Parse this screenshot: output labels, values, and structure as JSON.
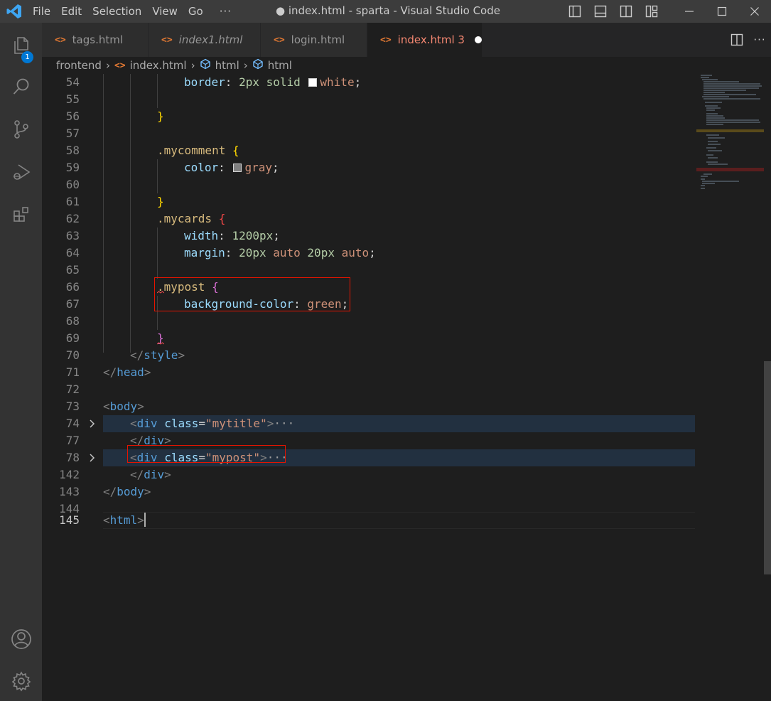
{
  "titlebar": {
    "menu": [
      "File",
      "Edit",
      "Selection",
      "View",
      "Go"
    ],
    "more": "···",
    "title": "● index.html - sparta - Visual Studio Code",
    "logo_icon": "vscode-logo-icon",
    "layout_icons": [
      "toggle-primary-sidebar-icon",
      "toggle-panel-icon",
      "toggle-secondary-sidebar-icon",
      "customize-layout-icon"
    ],
    "window_controls": [
      "minimize-icon",
      "maximize-icon",
      "close-icon"
    ]
  },
  "activity_bar": {
    "items": [
      "explorer-icon",
      "search-icon",
      "source-control-icon",
      "run-debug-icon",
      "extensions-icon"
    ],
    "explorer_badge": "1",
    "bottom": [
      "accounts-icon",
      "manage-gear-icon"
    ],
    "accent": "#0078d4"
  },
  "tabs": [
    {
      "label": "tags.html",
      "italic": false,
      "active": false
    },
    {
      "label": "index1.html",
      "italic": true,
      "active": false
    },
    {
      "label": "login.html",
      "italic": false,
      "active": false
    },
    {
      "label": "index.html 3",
      "italic": false,
      "active": true,
      "dirty": true
    }
  ],
  "tab_icon": "<>",
  "tab_actions": [
    "split-editor-icon",
    "more-actions-icon"
  ],
  "tab_more": "···",
  "breadcrumb": [
    "frontend",
    "index.html",
    "html",
    "html"
  ],
  "editor": {
    "lines": [
      {
        "n": "54"
      },
      {
        "n": "55"
      },
      {
        "n": "56"
      },
      {
        "n": "57"
      },
      {
        "n": "58"
      },
      {
        "n": "59"
      },
      {
        "n": "60"
      },
      {
        "n": "61"
      },
      {
        "n": "62"
      },
      {
        "n": "63"
      },
      {
        "n": "64"
      },
      {
        "n": "65"
      },
      {
        "n": "66"
      },
      {
        "n": "67"
      },
      {
        "n": "68"
      },
      {
        "n": "69"
      },
      {
        "n": "70"
      },
      {
        "n": "71"
      },
      {
        "n": "72"
      },
      {
        "n": "73"
      },
      {
        "n": "74"
      },
      {
        "n": "77"
      },
      {
        "n": "78"
      },
      {
        "n": "142"
      },
      {
        "n": "143"
      },
      {
        "n": "144"
      },
      {
        "n": "145"
      }
    ],
    "t": {
      "border": "border",
      "border_val": "2px solid ",
      "white": "white",
      "mycomment": ".mycomment",
      "color": "color",
      "gray": "gray",
      "mycards": ".mycards",
      "width": "width",
      "width_val": "1200px",
      "margin": "margin",
      "m20a": "20px",
      "auto1": "auto",
      "m20b": "20px",
      "auto2": "auto",
      "mypost": ".mypost",
      "bgcolor": "background-color",
      "green": "green",
      "style": "style",
      "head": "head",
      "body": "body",
      "div": "div",
      "class_attr": "class",
      "mytitle": "\"mytitle\"",
      "mypost_str": "\"mypost\"",
      "html": "html",
      "colon": ":",
      "semi": ";",
      "brace_open": "{",
      "brace_close": "}",
      "ellipsis": "···",
      "lt": "<",
      "lts": "</",
      "gt": ">",
      "eq": "="
    },
    "colors": {
      "swatch_white": "#ffffff",
      "swatch_gray": "#808080"
    }
  }
}
